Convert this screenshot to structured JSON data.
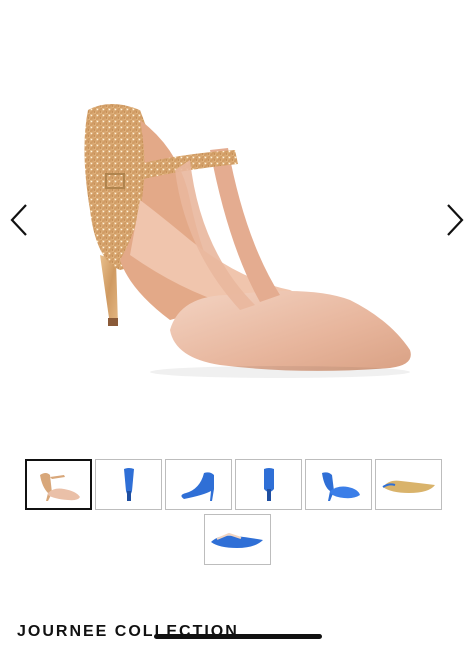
{
  "gallery": {
    "prev_icon": "chevron-left-icon",
    "next_icon": "chevron-right-icon",
    "main_image": "nude-satin-glitter-t-strap-pump",
    "thumbnails": [
      {
        "name": "nude-pump-side",
        "color": "#e8b9a0",
        "selected": true
      },
      {
        "name": "blue-pump-front",
        "color": "#2f6fd6",
        "selected": false
      },
      {
        "name": "blue-pump-side",
        "color": "#2f6fd6",
        "selected": false
      },
      {
        "name": "blue-pump-back",
        "color": "#2f6fd6",
        "selected": false
      },
      {
        "name": "blue-pump-angle",
        "color": "#2f6fd6",
        "selected": false
      },
      {
        "name": "sole-view",
        "color": "#d9b36b",
        "selected": false
      },
      {
        "name": "blue-pump-top",
        "color": "#2f6fd6",
        "selected": false
      }
    ]
  },
  "brand": {
    "name": "JOURNEE COLLECTION"
  }
}
